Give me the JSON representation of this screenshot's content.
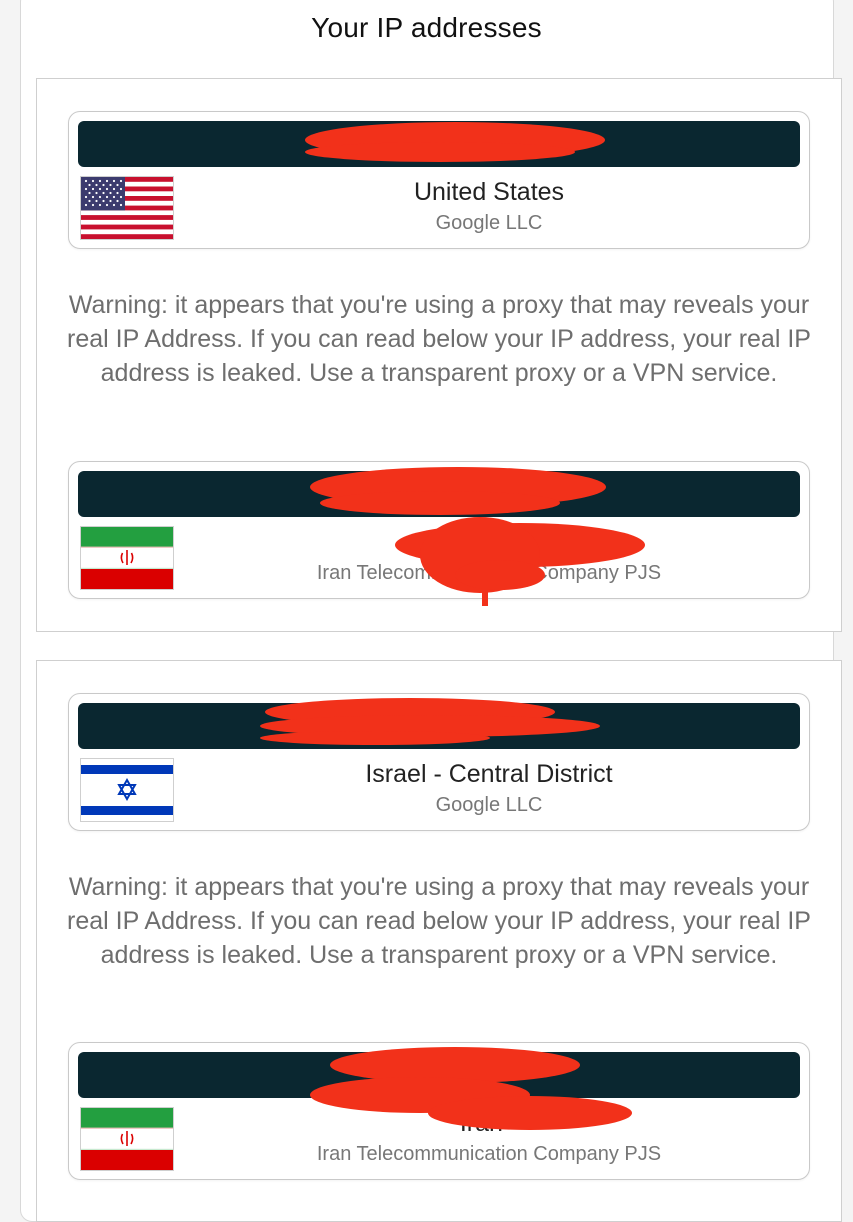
{
  "page": {
    "title": "Your IP addresses"
  },
  "sections": [
    {
      "public": {
        "ip": "",
        "flag": "us-flag",
        "country": "United States",
        "isp": "Google LLC"
      },
      "warning": "Warning: it appears that you're using a proxy that may reveals your real IP Address. If you can read below your IP address, your real IP address is leaked. Use a transparent proxy or a VPN service.",
      "leaked": {
        "ip": "",
        "flag": "iran-flag",
        "country": "Iran",
        "isp": "Iran Telecommunication Company PJS"
      }
    },
    {
      "public": {
        "ip": "",
        "flag": "israel-flag",
        "country": "Israel - Central District",
        "isp": "Google LLC"
      },
      "warning": "Warning: it appears that you're using a proxy that may reveals your real IP Address. If you can read below your IP address, your real IP address is leaked. Use a transparent proxy or a VPN service.",
      "leaked": {
        "ip": "",
        "flag": "iran-flag",
        "country": "Iran -",
        "isp": "Iran Telecommunication Company PJS"
      }
    }
  ],
  "colors": {
    "ip_bar": "#0a2730",
    "redaction": "#f2311a",
    "warning_text": "#6e6e6e",
    "isp_text": "#777777"
  }
}
